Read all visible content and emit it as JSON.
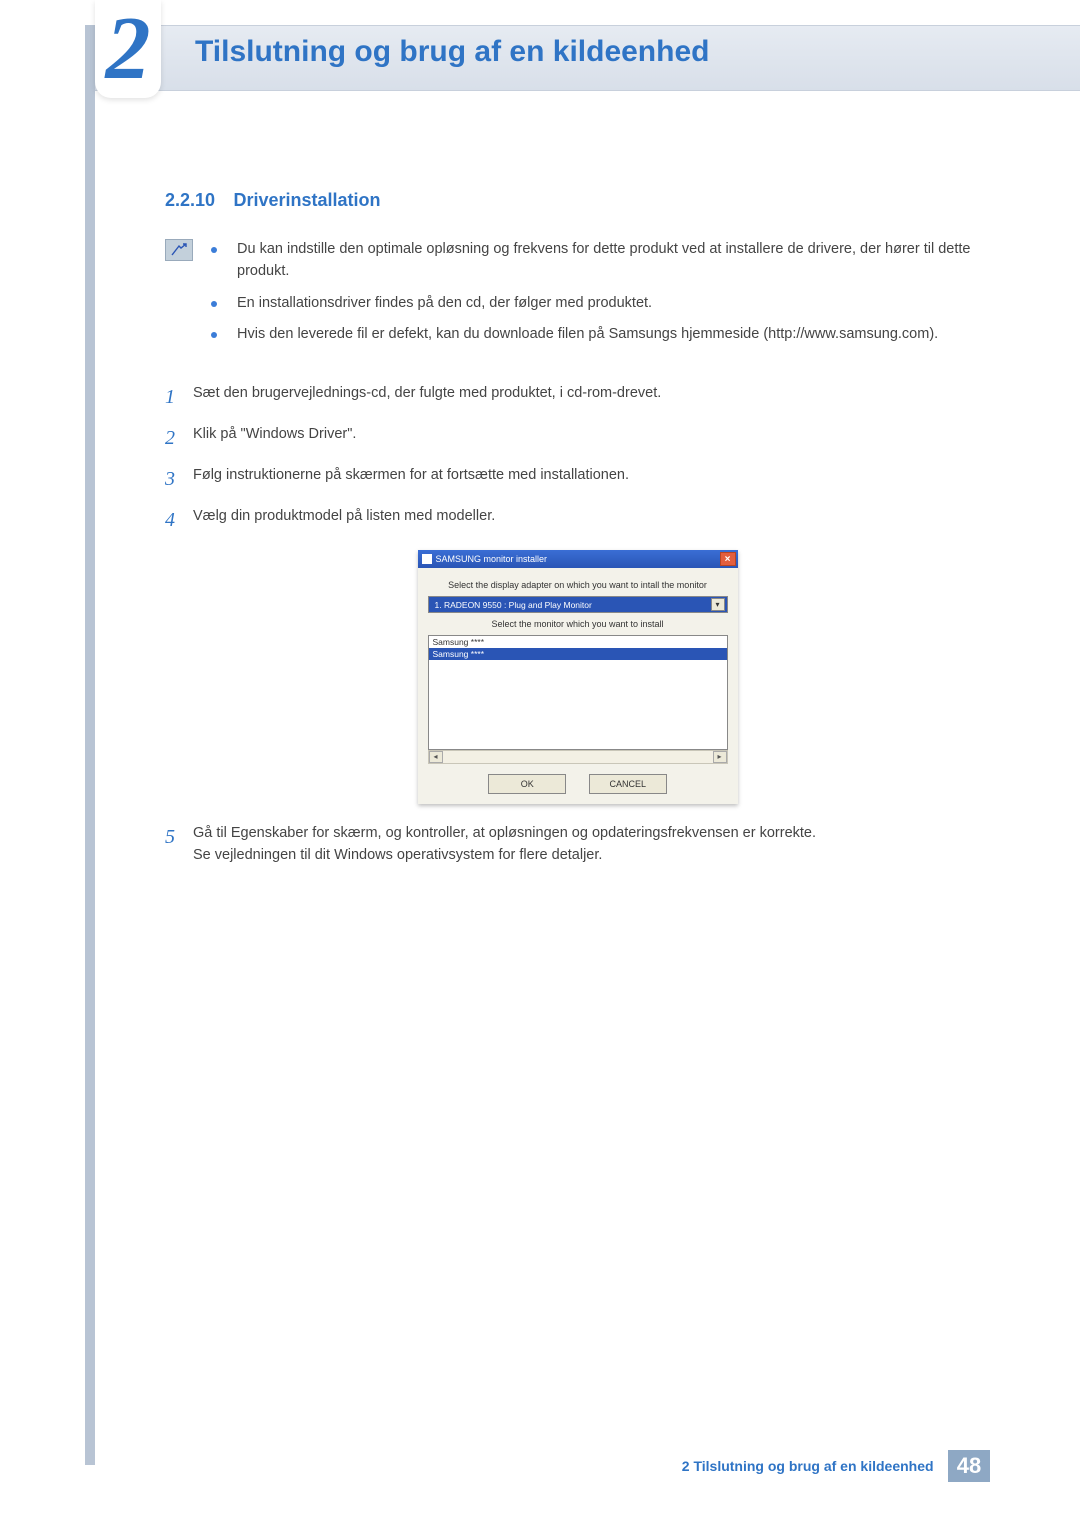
{
  "chapter": {
    "number": "2",
    "title": "Tilslutning og brug af en kildeenhed"
  },
  "section": {
    "number": "2.2.10",
    "title": "Driverinstallation"
  },
  "notes": [
    "Du kan indstille den optimale opløsning og frekvens for dette produkt ved at installere de drivere, der hører til dette produkt.",
    "En installationsdriver findes på den cd, der følger med produktet.",
    "Hvis den leverede fil er defekt, kan du downloade filen på Samsungs hjemmeside (http://www.samsung.com)."
  ],
  "steps": {
    "s1": "Sæt den brugervejlednings-cd, der fulgte med produktet, i cd-rom-drevet.",
    "s2": "Klik på \"Windows Driver\".",
    "s3": "Følg instruktionerne på skærmen for at fortsætte med installationen.",
    "s4": "Vælg din produktmodel på listen med modeller.",
    "s5a": "Gå til Egenskaber for skærm, og kontroller, at opløsningen og opdateringsfrekvensen er korrekte.",
    "s5b": "Se vejledningen til dit Windows operativsystem for flere detaljer."
  },
  "step_numbers": {
    "n1": "1",
    "n2": "2",
    "n3": "3",
    "n4": "4",
    "n5": "5"
  },
  "dialog": {
    "title": "SAMSUNG monitor installer",
    "label_adapter": "Select the display adapter on which you want to intall the monitor",
    "adapter_value": "1. RADEON 9550 : Plug and Play Monitor",
    "label_monitor": "Select the monitor which you want to install",
    "list_item0": "Samsung ****",
    "list_item1": "Samsung ****",
    "ok": "OK",
    "cancel": "CANCEL",
    "close": "×"
  },
  "footer": {
    "text": "2 Tilslutning og brug af en kildeenhed",
    "page": "48"
  }
}
